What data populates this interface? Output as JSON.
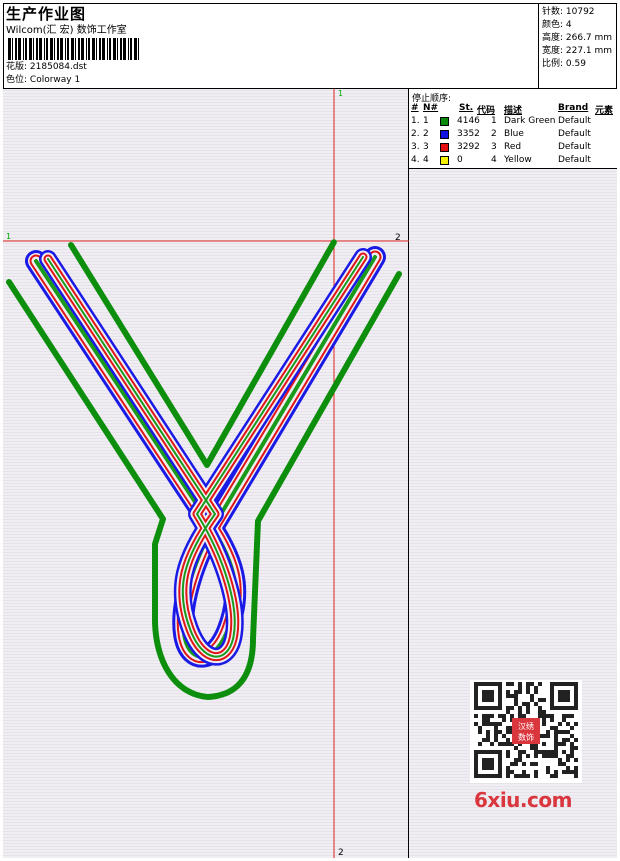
{
  "header": {
    "title": "生产作业图",
    "company": "Wilcom(汇 宏) 数饰工作室",
    "design_label": "花版:",
    "design_file": "2185084.dst",
    "colorway_label": "色位:",
    "colorway": "Colorway 1"
  },
  "stats": {
    "stitches": "针数: 10792",
    "colors": "颜色: 4",
    "height": "高度: 266.7 mm",
    "width": "宽度: 227.1 mm",
    "scale": "比例: 0.59"
  },
  "stop_sequence": {
    "title": "停止顺序:",
    "columns": {
      "num": "#",
      "n": "N#",
      "st": "St.",
      "code": "代码",
      "desc": "描述",
      "brand": "Brand",
      "elem": "元素"
    },
    "rows": [
      {
        "num": "1.",
        "n": "1",
        "st": "4146",
        "code": "1",
        "desc": "Dark Green",
        "brand": "Default",
        "color": "#0a8a0a"
      },
      {
        "num": "2.",
        "n": "2",
        "st": "3352",
        "code": "2",
        "desc": "Blue",
        "brand": "Default",
        "color": "#1010e0"
      },
      {
        "num": "3.",
        "n": "3",
        "st": "3292",
        "code": "3",
        "desc": "Red",
        "brand": "Default",
        "color": "#e01010"
      },
      {
        "num": "4.",
        "n": "4",
        "st": "0",
        "code": "4",
        "desc": "Yellow",
        "brand": "Default",
        "color": "#f5f000"
      }
    ]
  },
  "guides": {
    "v_top": "1",
    "v_bottom": "2",
    "h_left": "1",
    "h_right": "2"
  },
  "watermark": "6xiu.com",
  "qr_seal": "汉绣数饰"
}
